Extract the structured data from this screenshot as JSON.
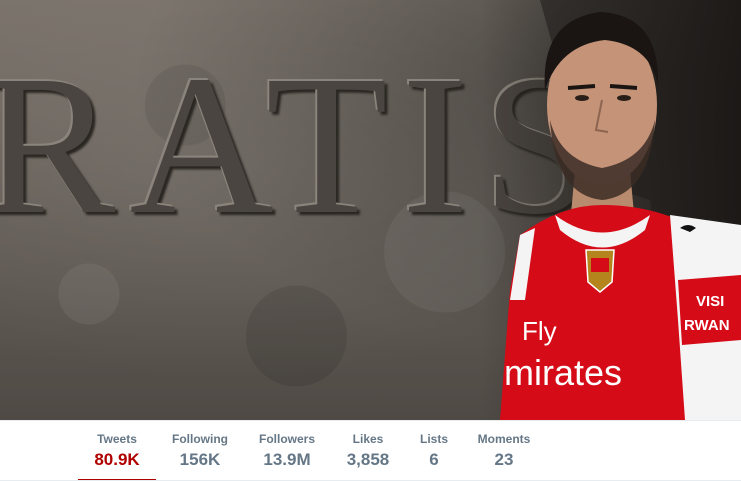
{
  "banner": {
    "carved_text": "RATIS",
    "shirt_sponsor_line1": "Fly",
    "shirt_sponsor_line2": "mirates",
    "sleeve_text_line1": "VISI",
    "sleeve_text_line2": "RWAN",
    "colors": {
      "shirt_red": "#d50b17",
      "sleeve_white": "#f4f4f4"
    }
  },
  "stats": [
    {
      "label": "Tweets",
      "value": "80.9K",
      "active": true
    },
    {
      "label": "Following",
      "value": "156K",
      "active": false
    },
    {
      "label": "Followers",
      "value": "13.9M",
      "active": false
    },
    {
      "label": "Likes",
      "value": "3,858",
      "active": false
    },
    {
      "label": "Lists",
      "value": "6",
      "active": false
    },
    {
      "label": "Moments",
      "value": "23",
      "active": false
    }
  ],
  "colors": {
    "accent": "#b00000",
    "muted_text": "#657786"
  }
}
